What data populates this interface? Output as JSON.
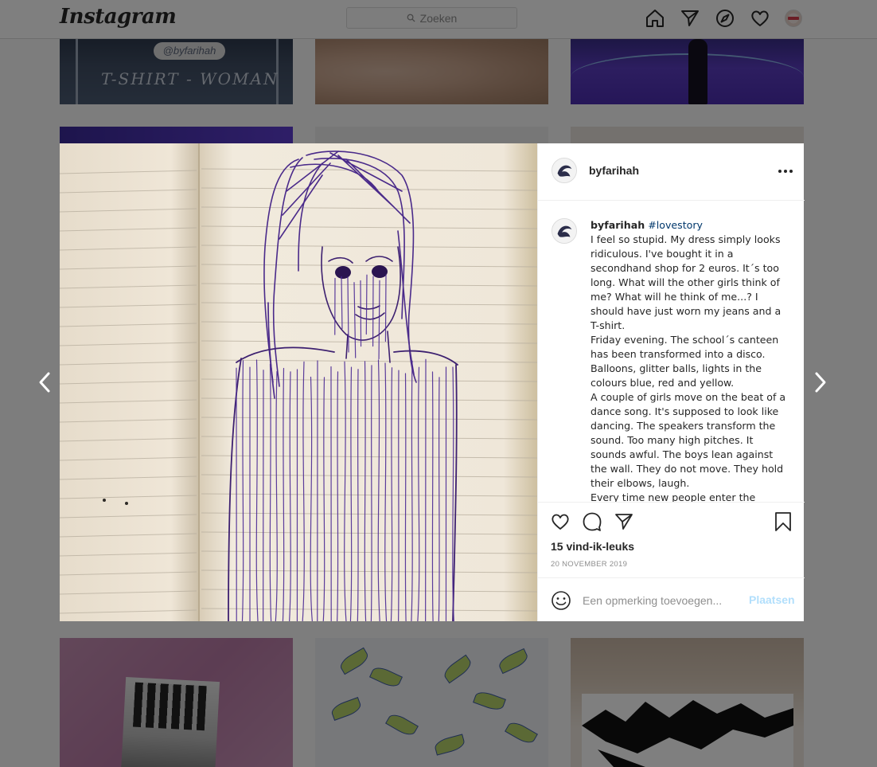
{
  "brand": {
    "logo_text": "Instagram"
  },
  "search": {
    "placeholder": "Zoeken"
  },
  "nav": {
    "icons": [
      "home-icon",
      "direct-icon",
      "explore-icon",
      "activity-icon",
      "profile-avatar"
    ]
  },
  "grid": {
    "tile_text": {
      "shirt_tag": "@byfarihah",
      "shirt_text": "T-SHIRT - WOMAN"
    }
  },
  "post": {
    "username": "byfarihah",
    "caption": {
      "username": "byfarihah",
      "hashtag": "#lovestory",
      "paragraphs": [
        "I feel so stupid. My dress simply looks ridiculous. I've bought it in a secondhand shop for 2 euros. It´s too long. What will the other girls think of me? What will he think of me...? I should have just worn my jeans and a T-shirt.",
        "Friday evening. The school´s canteen has been transformed into a disco. Balloons, glitter balls, lights in the colours blue, red and yellow.",
        "A couple of girls move on the beat of a dance song. It's supposed to look like dancing. The speakers transform the sound. Too many high pitches. It sounds awful. The boys lean against the wall. They do not move. They hold their elbows, laugh.",
        "Every time new people enter the"
      ]
    },
    "likes": "15 vind-ik-leuks",
    "date": "20 NOVEMBER 2019",
    "comment": {
      "placeholder": "Een opmerking toevoegen...",
      "value": ""
    },
    "post_button": "Plaatsen"
  },
  "colors": {
    "text": "#262626",
    "muted": "#8e8e8e",
    "border": "#dbdbdb",
    "hashtag": "#00376b",
    "post_button_disabled": "#b2dffc",
    "ink": "#4a2a8a"
  }
}
